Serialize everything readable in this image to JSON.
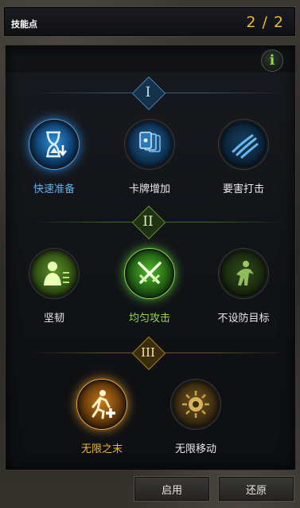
{
  "header": {
    "title": "技能点",
    "points": "2 / 2"
  },
  "info_icon": "i",
  "colors": {
    "blue": "#5fb3f0",
    "green": "#8ee046",
    "gold": "#f0b92a",
    "white": "#e8e8e8"
  },
  "tiers": [
    {
      "numeral": "I",
      "color": "#5fb3f0",
      "skills": [
        {
          "name": "快速准备",
          "state": "selected",
          "icon": "hourglass-icon"
        },
        {
          "name": "卡牌增加",
          "state": "available",
          "icon": "cards-icon"
        },
        {
          "name": "要害打击",
          "state": "available",
          "icon": "claw-slash-icon"
        }
      ]
    },
    {
      "numeral": "II",
      "color": "#8ee046",
      "skills": [
        {
          "name": "坚韧",
          "state": "available",
          "icon": "figure-icon"
        },
        {
          "name": "均匀攻击",
          "state": "selected",
          "icon": "crossed-swords-icon"
        },
        {
          "name": "不设防目标",
          "state": "available",
          "icon": "ghoul-icon"
        }
      ]
    },
    {
      "numeral": "III",
      "color": "#f0b92a",
      "skills": [
        {
          "name": "无限之末",
          "state": "selected",
          "icon": "runner-plus-icon"
        },
        {
          "name": "无限移动",
          "state": "available",
          "icon": "sunburst-icon"
        }
      ]
    }
  ],
  "buttons": {
    "apply": "启用",
    "reset": "还原"
  }
}
